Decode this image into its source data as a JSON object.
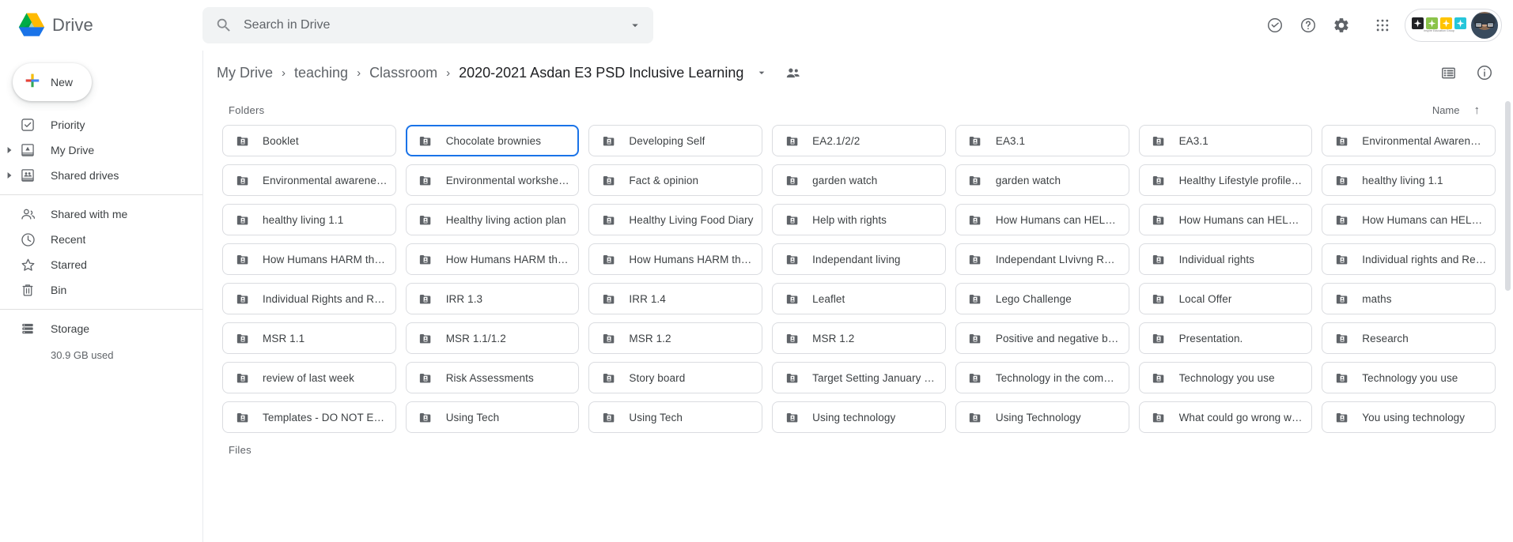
{
  "app": {
    "name": "Drive",
    "logo_colors": {
      "blue": "#1a73e8",
      "green": "#00ac47",
      "yellow": "#ffba00",
      "red": "#ea4335"
    }
  },
  "search": {
    "placeholder": "Search in Drive",
    "value": "",
    "icon": "search-icon",
    "options_icon": "chevron-down-icon"
  },
  "topbar_actions": [
    {
      "name": "support-icon",
      "label": "Support"
    },
    {
      "name": "help-icon",
      "label": "Help"
    },
    {
      "name": "settings-gear-icon",
      "label": "Settings"
    },
    {
      "name": "apps-grid-icon",
      "label": "Google apps"
    }
  ],
  "org_badge": {
    "subtitle": "Inspire Education Group",
    "tile_colors": [
      "#202124",
      "#8bc34a",
      "#ffc400",
      "#26c6da"
    ]
  },
  "account": {
    "avatar_label": "Account"
  },
  "sidebar": {
    "new_button": {
      "label": "New",
      "icon": "plus-icon"
    },
    "items": [
      {
        "label": "Priority",
        "icon": "priority-check-icon",
        "expandable": false
      },
      {
        "label": "My Drive",
        "icon": "my-drive-icon",
        "expandable": true
      },
      {
        "label": "Shared drives",
        "icon": "shared-drives-icon",
        "expandable": true
      },
      {
        "label": "Shared with me",
        "icon": "people-icon",
        "expandable": false
      },
      {
        "label": "Recent",
        "icon": "clock-icon",
        "expandable": false
      },
      {
        "label": "Starred",
        "icon": "star-icon",
        "expandable": false
      },
      {
        "label": "Bin",
        "icon": "trash-icon",
        "expandable": false
      },
      {
        "label": "Storage",
        "icon": "storage-icon",
        "expandable": false
      }
    ],
    "storage_used": "30.9 GB used"
  },
  "breadcrumb": {
    "items": [
      "My Drive",
      "teaching",
      "Classroom",
      "2020-2021 Asdan E3 PSD Inclusive Learning"
    ],
    "separator": "›",
    "caret_icon": "chevron-down-icon",
    "share_icon": "add-people-icon"
  },
  "view_actions": [
    {
      "name": "list-view-icon",
      "label": "List view"
    },
    {
      "name": "details-info-icon",
      "label": "View details"
    }
  ],
  "main": {
    "folders_heading": "Folders",
    "files_heading": "Files",
    "sort": {
      "field": "Name",
      "direction_icon": "↑"
    },
    "selected_folder": "Chocolate brownies",
    "folders": [
      "Booklet",
      "Chocolate brownies",
      "Developing Self",
      "EA2.1/2/2",
      "EA3.1",
      "EA3.1",
      "Environmental Awareness",
      "Environmental awarenes…",
      "Environmental workshee…",
      "Fact & opinion",
      "garden watch",
      "garden watch",
      "Healthy Lifestyle profile …",
      "healthy living 1.1",
      "healthy living 1.1",
      "Healthy living action plan",
      "Healthy Living Food Diary",
      "Help with rights",
      "How Humans can HELP …",
      "How Humans can HELP …",
      "How Humans can HELP …",
      "How Humans HARM the …",
      "How Humans HARM the …",
      "How Humans HARM the …",
      "Independant living",
      "Independant LIvivng Rec…",
      "Individual rights",
      "Individual rights and Res…",
      "Individual Rights and Re…",
      "IRR 1.3",
      "IRR 1.4",
      "Leaflet",
      "Lego Challenge",
      "Local Offer",
      "maths",
      "MSR 1.1",
      "MSR 1.1/1.2",
      "MSR 1.2",
      "MSR 1.2",
      "Positive and negative be…",
      "Presentation.",
      "Research",
      "review of last week",
      "Risk Assessments",
      "Story board",
      "Target Setting January &…",
      "Technology in the comm…",
      "Technology you use",
      "Technology you use",
      "Templates - DO NOT EDIT",
      "Using Tech",
      "Using Tech",
      "Using technology",
      "Using Technology",
      "What could go wrong wit…",
      "You using technology"
    ]
  }
}
